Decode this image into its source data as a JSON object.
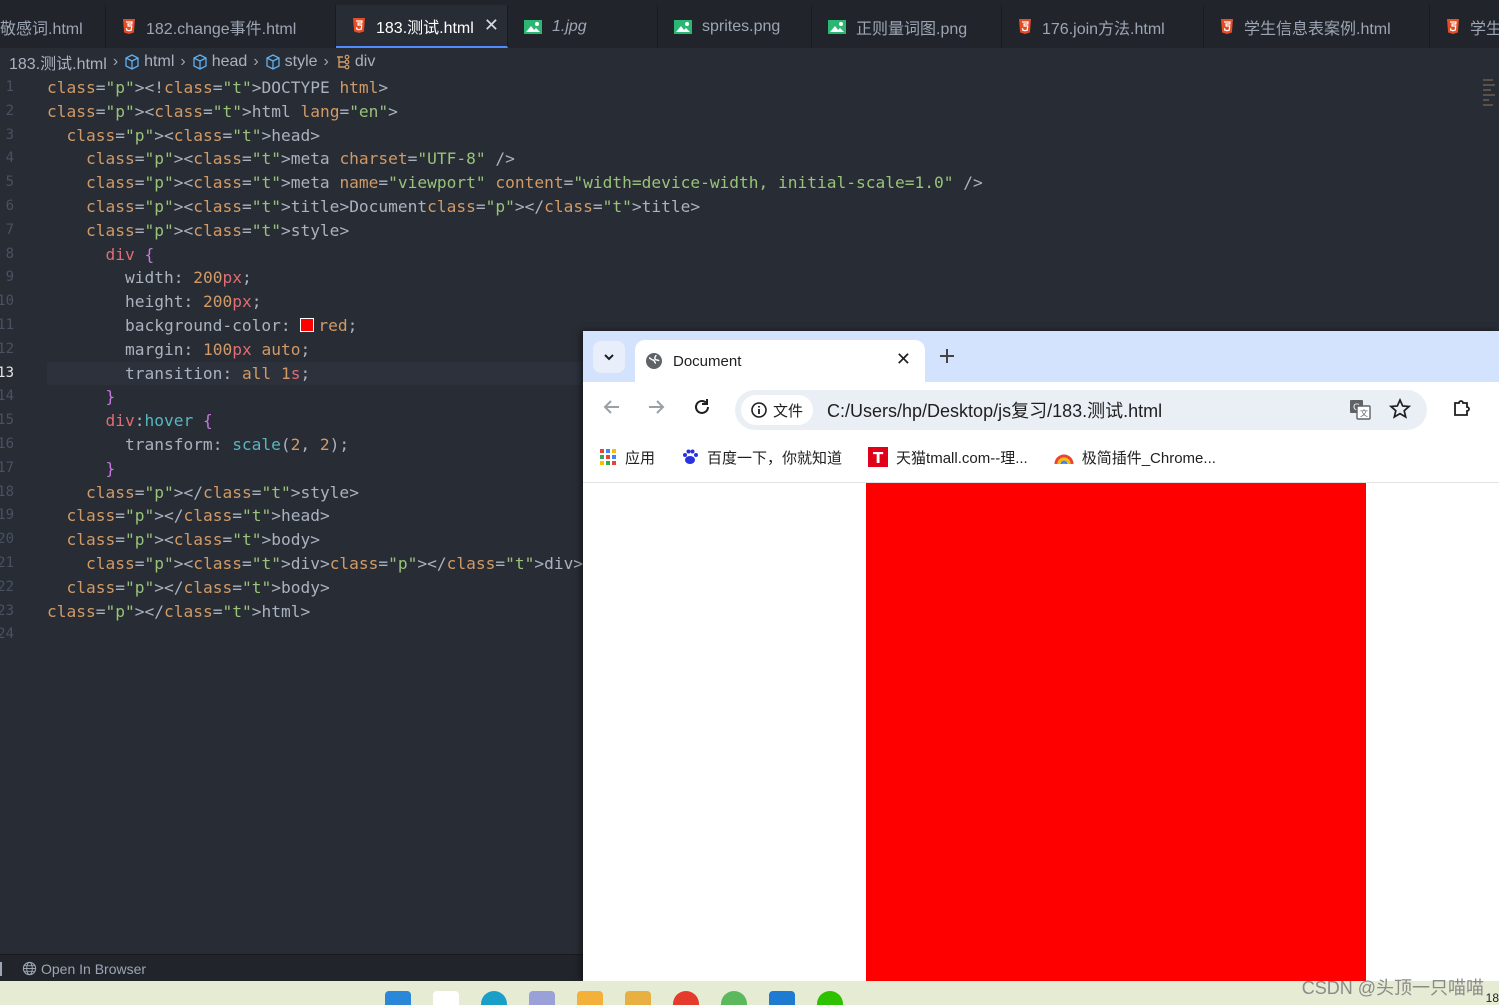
{
  "editor": {
    "tabs": [
      {
        "label": "敬感词.html",
        "type": "html",
        "active": false
      },
      {
        "label": "182.change事件.html",
        "type": "html",
        "active": false
      },
      {
        "label": "183.测试.html",
        "type": "html",
        "active": true
      },
      {
        "label": "1.jpg",
        "type": "image",
        "active": false
      },
      {
        "label": "sprites.png",
        "type": "image",
        "active": false
      },
      {
        "label": "正则量词图.png",
        "type": "image",
        "active": false
      },
      {
        "label": "176.join方法.html",
        "type": "html",
        "active": false
      },
      {
        "label": "学生信息表案例.html",
        "type": "html",
        "active": false
      },
      {
        "label": "学生",
        "type": "html",
        "active": false
      }
    ],
    "breadcrumb": [
      "183.测试.html",
      "html",
      "head",
      "style",
      "div"
    ],
    "current_line": "13",
    "line_numbers": [
      "1",
      "2",
      "3",
      "4",
      "5",
      "6",
      "7",
      "8",
      "9",
      "10",
      "11",
      "12",
      "13",
      "14",
      "15",
      "16",
      "17",
      "18",
      "19",
      "20",
      "21",
      "22",
      "23",
      "24"
    ],
    "lines": [
      "<!DOCTYPE html>",
      "<html lang=\"en\">",
      "  <head>",
      "    <meta charset=\"UTF-8\" />",
      "    <meta name=\"viewport\" content=\"width=device-width, initial-scale=1.0\" />",
      "    <title>Document</title>",
      "    <style>",
      "      div {",
      "        width: 200px;",
      "        height: 200px;",
      "        background-color: red;",
      "        margin: 100px auto;",
      "        transition: all 1s;",
      "      }",
      "      div:hover {",
      "        transform: scale(2, 2);",
      "      }",
      "    </style>",
      "  </head>",
      "  <body>",
      "    <div></div>",
      "  </body>",
      "</html>",
      ""
    ],
    "statusbar": {
      "open_in_browser": "Open In Browser"
    }
  },
  "browser": {
    "tab_title": "Document",
    "info_chip": "文件",
    "url": "C:/Users/hp/Desktop/js复习/183.测试.html",
    "bookmarks": [
      {
        "label": "应用",
        "icon": "apps-grid-icon"
      },
      {
        "label": "百度一下，你就知道",
        "icon": "baidu-icon"
      },
      {
        "label": "天猫tmall.com--理...",
        "icon": "tmall-icon"
      },
      {
        "label": "极简插件_Chrome...",
        "icon": "extension-site-icon"
      }
    ],
    "page_box_color": "#ff0000"
  },
  "watermark": "CSDN @头顶一只喵喵",
  "clock": "18"
}
